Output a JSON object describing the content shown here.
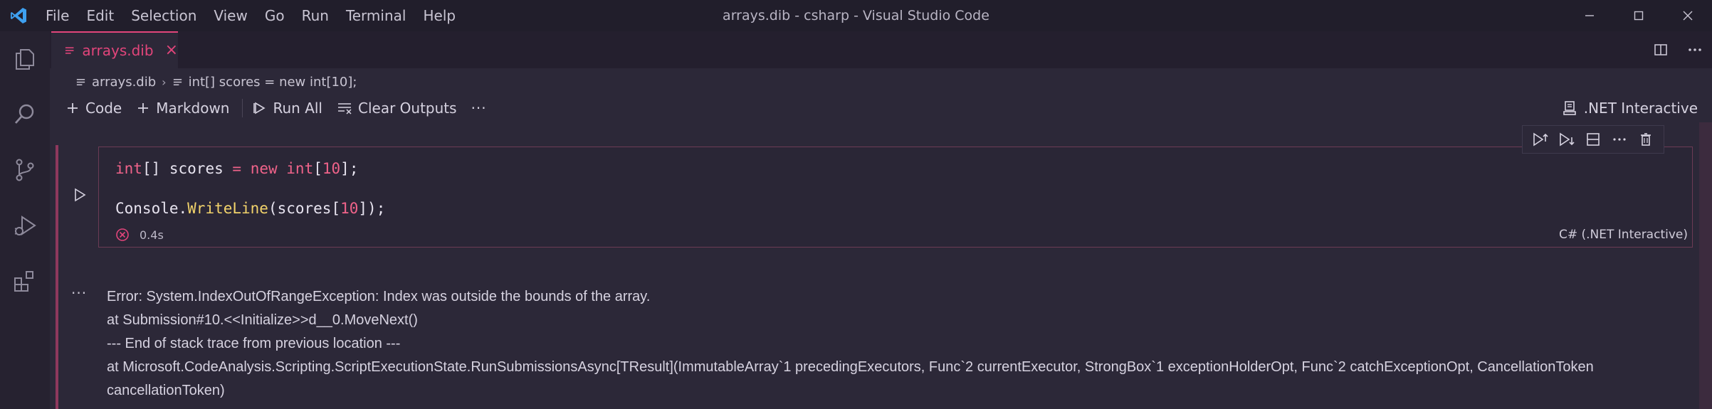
{
  "titlebar": {
    "menu": [
      "File",
      "Edit",
      "Selection",
      "View",
      "Go",
      "Run",
      "Terminal",
      "Help"
    ],
    "window_title": "arrays.dib - csharp - Visual Studio Code",
    "accent": "#e2457b"
  },
  "activity_bar": {
    "icons": [
      "files-icon",
      "search-icon",
      "source-control-icon",
      "run-debug-icon",
      "extensions-icon"
    ]
  },
  "tab": {
    "label": "arrays.dib",
    "close": "×"
  },
  "breadcrumb": {
    "file": "arrays.dib",
    "symbol": "int[] scores = new int[10];"
  },
  "toolbar": {
    "code_label": "Code",
    "markdown_label": "Markdown",
    "run_all_label": "Run All",
    "clear_outputs_label": "Clear Outputs",
    "more": "···",
    "kernel_label": ".NET Interactive"
  },
  "cell": {
    "code_lines": [
      "int[] scores = new int[10];",
      "Console.WriteLine(scores[10]);"
    ],
    "duration": "0.4s",
    "language": "C# (.NET Interactive)",
    "status": "error"
  },
  "output": {
    "menu": "···",
    "lines": [
      "Error: System.IndexOutOfRangeException: Index was outside the bounds of the array.",
      "at Submission#10.<<Initialize>>d__0.MoveNext()",
      "--- End of stack trace from previous location ---",
      "at Microsoft.CodeAnalysis.Scripting.ScriptExecutionState.RunSubmissionsAsync[TResult](ImmutableArray`1 precedingExecutors, Func`2 currentExecutor, StrongBox`1 exceptionHolderOpt, Func`2 catchExceptionOpt, CancellationToken cancellationToken)"
    ]
  }
}
